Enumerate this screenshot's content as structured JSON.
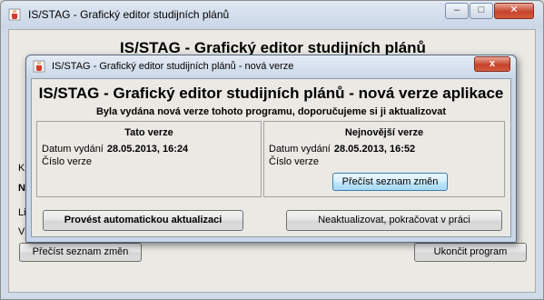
{
  "background_window": {
    "title": "IS/STAG - Grafický editor studijních plánů",
    "heading": "IS/STAG - Grafický editor studijních plánů",
    "left_fragments": [
      "K",
      "N",
      "Li",
      "V"
    ],
    "left_button_label": "Přečíst seznam změn",
    "right_button_label": "Ukončit program",
    "controls": {
      "minimize": "–",
      "maximize": "□",
      "close": "✕"
    }
  },
  "dialog": {
    "title": "IS/STAG - Grafický editor studijních plánů - nová verze",
    "close_label": "x",
    "heading": "IS/STAG - Grafický editor studijních plánů - nová verze aplikace",
    "subheading": "Byla vydána nová verze tohoto programu, doporučujeme si ji aktualizovat",
    "current": {
      "title": "Tato verze",
      "date_label": "Datum vydání",
      "date_value": "28.05.2013, 16:24",
      "version_label": "Číslo verze",
      "version_value": ""
    },
    "latest": {
      "title": "Nejnovější verze",
      "date_label": "Datum vydání",
      "date_value": "28.05.2013, 16:52",
      "version_label": "Číslo verze",
      "version_value": "",
      "changes_button": "Přečíst seznam změn"
    },
    "update_button": "Provést automatickou aktualizaci",
    "skip_button": "Neaktualizovat, pokračovat v práci"
  },
  "colors": {
    "title_bar": "#cbd8e8",
    "client_bg": "#ebe9e4",
    "close_button": "#c7432c",
    "focus_button": "#bee6fd"
  },
  "icons": {
    "app": "java-cup-icon"
  }
}
